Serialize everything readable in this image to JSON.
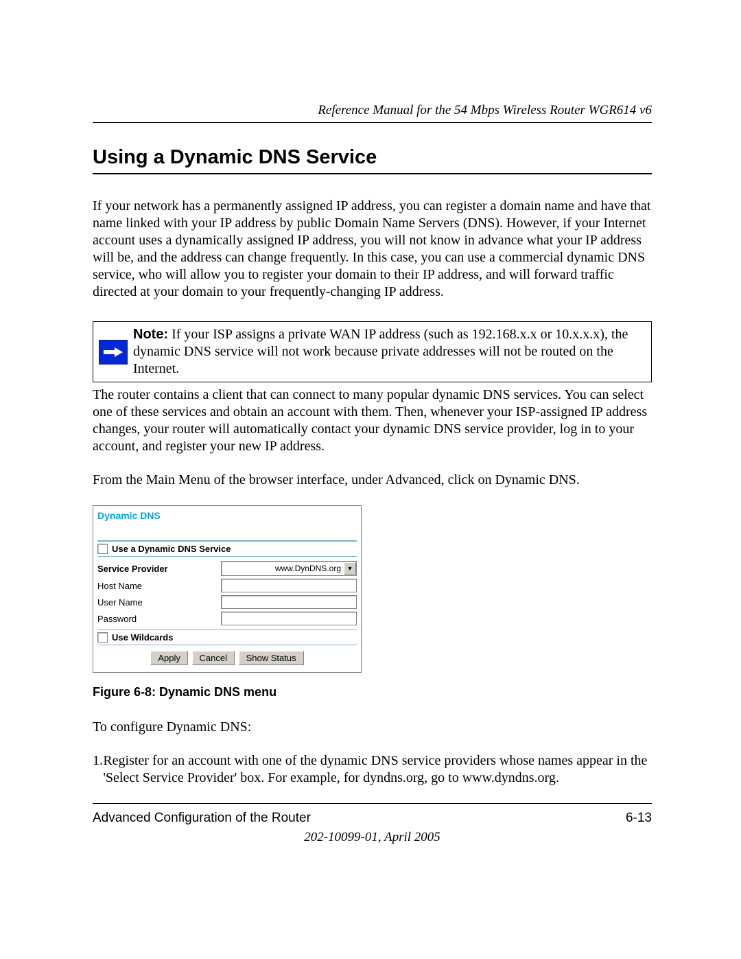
{
  "running_head": "Reference Manual for the 54 Mbps Wireless Router WGR614 v6",
  "section_title": "Using a Dynamic DNS Service",
  "para1": "If your network has a permanently assigned IP address, you can register a domain name and have that name linked with your IP address by public Domain Name Servers (DNS). However, if your Internet account uses a dynamically assigned IP address, you will not know in advance what your IP address will be, and the address can change frequently. In this case, you can use a commercial dynamic DNS service, who will allow you to register your domain to their IP address, and will forward traffic directed at your domain to your frequently-changing IP address.",
  "note_label": "Note:",
  "note_text": " If your ISP assigns a private WAN IP address (such as 192.168.x.x or 10.x.x.x), the dynamic DNS service will not work because private addresses will not be routed on the Internet.",
  "para2": "The router contains a client that can connect to many popular dynamic DNS services. You can select one of these services and obtain an account with them. Then, whenever your ISP-assigned IP address changes, your router will automatically contact your dynamic DNS service provider, log in to your account, and register your new IP address.",
  "para3": "From the Main Menu of the browser interface, under Advanced, click on Dynamic DNS.",
  "screenshot": {
    "title": "Dynamic DNS",
    "use_service_label": "Use a Dynamic DNS Service",
    "service_provider_label": "Service Provider",
    "service_provider_value": "www.DynDNS.org",
    "host_name_label": "Host Name",
    "user_name_label": "User Name",
    "password_label": "Password",
    "wildcards_label": "Use Wildcards",
    "apply_btn": "Apply",
    "cancel_btn": "Cancel",
    "show_status_btn": "Show Status"
  },
  "figure_caption": "Figure 6-8:  Dynamic DNS menu",
  "para4": "To configure Dynamic DNS:",
  "step1_num": "1.",
  "step1_text": "Register for an account with one of the dynamic DNS service providers whose names appear in the 'Select Service Provider' box. For example, for dyndns.org, go to www.dyndns.org.",
  "footer_left": "Advanced Configuration of the Router",
  "footer_right": "6-13",
  "footer_center": "202-10099-01, April 2005"
}
